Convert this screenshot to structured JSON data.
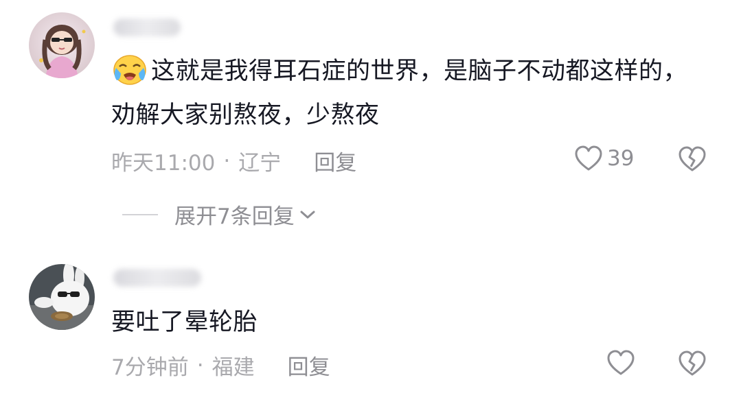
{
  "comments": [
    {
      "avatar_icon": "anime-girl-avatar-icon",
      "username_blurred": true,
      "emoji": "loudly-crying-face-emoji",
      "text": "这就是我得耳石症的世界，是脑子不动都这样的，劝解大家别熬夜，少熬夜",
      "time": "昨天11:00",
      "separator": "·",
      "location": "辽宁",
      "reply_label": "回复",
      "like_count": "39",
      "expand_label": "展开7条回复"
    },
    {
      "avatar_icon": "white-rabbit-sunglasses-avatar-icon",
      "username_blurred": true,
      "text": "要吐了晕轮胎",
      "time": "7分钟前",
      "separator": "·",
      "location": "福建",
      "reply_label": "回复",
      "like_count": ""
    }
  ],
  "colors": {
    "text_primary": "#161823",
    "text_secondary": "#a9a9ad",
    "icon_gray": "#8e8e93"
  }
}
